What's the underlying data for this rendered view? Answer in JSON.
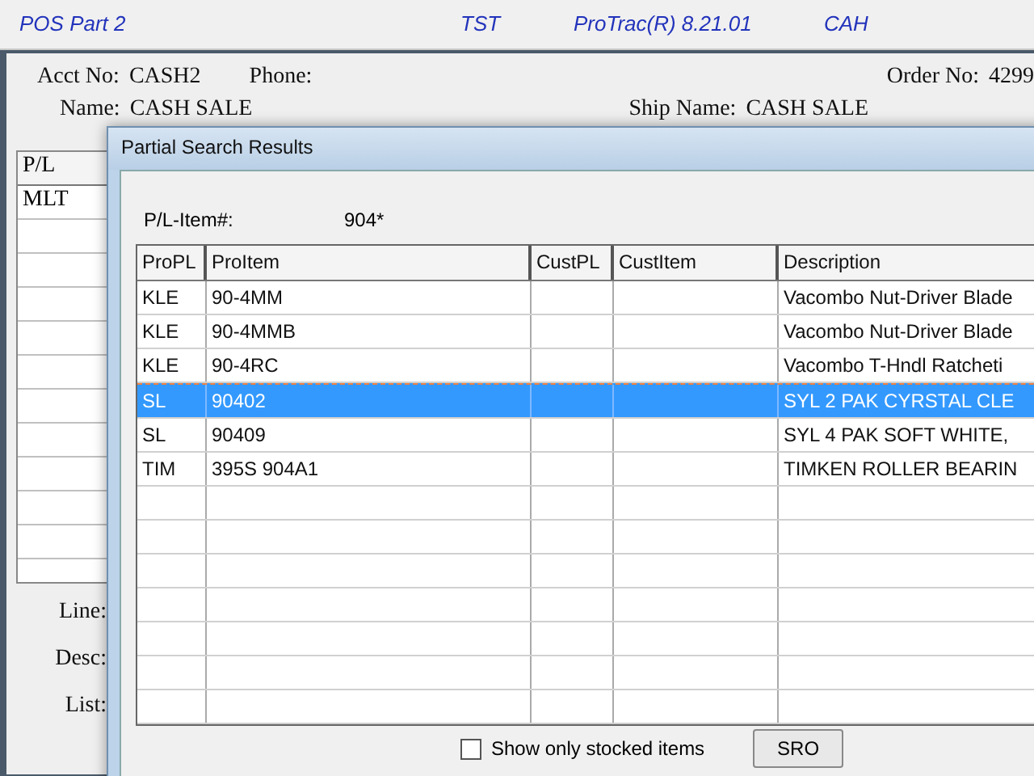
{
  "app_bar": {
    "title": "POS Part 2",
    "env": "TST",
    "version": "ProTrac(R) 8.21.01",
    "user": "CAH"
  },
  "order": {
    "acct": {
      "label": "Acct No:",
      "value": "CASH2"
    },
    "phone": {
      "label": "Phone:"
    },
    "order_no": {
      "label": "Order No:",
      "value": "4299"
    },
    "name": {
      "label": "Name:",
      "value": "CASH SALE"
    },
    "ship_name": {
      "label": "Ship Name:",
      "value": "CASH SALE"
    }
  },
  "lines_grid": {
    "columns": [
      "P/L"
    ],
    "rows": [
      [
        "MLT"
      ]
    ]
  },
  "line_labels": [
    "Line:",
    "Desc:",
    "List:"
  ],
  "dialog": {
    "title": "Partial Search Results",
    "search_label": "P/L-Item#:",
    "search_value": "904*",
    "columns": [
      "ProPL",
      "ProItem",
      "CustPL",
      "CustItem",
      "Description"
    ],
    "rows": [
      {
        "cells": [
          "KLE",
          "90-4MM",
          "",
          "",
          "Vacombo Nut-Driver Blade"
        ],
        "selected": false
      },
      {
        "cells": [
          "KLE",
          "90-4MMB",
          "",
          "",
          "Vacombo Nut-Driver Blade"
        ],
        "selected": false
      },
      {
        "cells": [
          "KLE",
          "90-4RC",
          "",
          "",
          "Vacombo T-Hndl Ratcheti"
        ],
        "selected": false
      },
      {
        "cells": [
          "SL",
          "90402",
          "",
          "",
          "SYL 2 PAK CYRSTAL CLE"
        ],
        "selected": true
      },
      {
        "cells": [
          "SL",
          "90409",
          "",
          "",
          "SYL 4 PAK SOFT WHITE,"
        ],
        "selected": false
      },
      {
        "cells": [
          "TIM",
          "395S 904A1",
          "",
          "",
          "TIMKEN ROLLER BEARIN"
        ],
        "selected": false
      }
    ],
    "stocked_only": {
      "label": "Show only stocked items",
      "checked": false
    },
    "buttons": [
      "SRO"
    ]
  }
}
